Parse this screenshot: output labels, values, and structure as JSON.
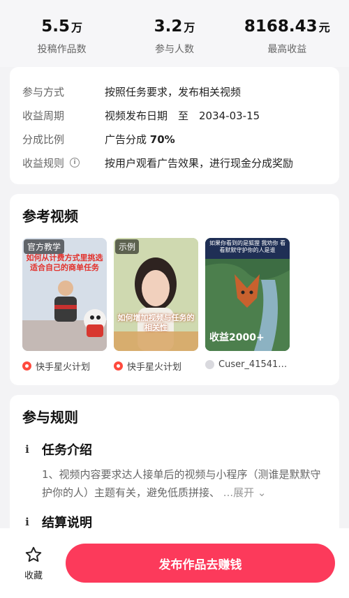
{
  "stats": [
    {
      "value": "5.5",
      "unit": "万",
      "label": "投稿作品数"
    },
    {
      "value": "3.2",
      "unit": "万",
      "label": "参与人数"
    },
    {
      "value": "8168.43",
      "unit": "元",
      "label": "最高收益"
    }
  ],
  "info": {
    "rows": [
      {
        "key": "参与方式",
        "value": "按照任务要求，发布相关视频"
      },
      {
        "key": "收益周期",
        "value": "视频发布日期　至　2034-03-15"
      },
      {
        "key": "分成比例",
        "value_prefix": "广告分成 ",
        "value_bold": "70%"
      },
      {
        "key": "收益规则",
        "value": "按用户观看广告效果，进行现金分成奖励",
        "icon": "info-circle-icon"
      }
    ]
  },
  "reference": {
    "title": "参考视频",
    "videos": [
      {
        "tag": "官方教学",
        "overlay": "如何从计费方式里挑选 适合自己的商单任务",
        "author": "快手星火计划",
        "author_icon": "kuaishou-logo-icon"
      },
      {
        "tag": "示例",
        "overlay": "如何增加视频与任务的 相关性",
        "author": "快手星火计划",
        "author_icon": "kuaishou-logo-icon"
      },
      {
        "tag": "",
        "overlay": "如果你看到的是狐狸 我劝你 看看默默守护你的人是谁",
        "badge": "收益2000+",
        "author": "Cuser_4154106...",
        "author_icon": "user-avatar-icon"
      }
    ]
  },
  "rules": {
    "title": "参与规则",
    "items": [
      {
        "title": "任务介绍",
        "body": "1、视频内容要求达人接单后的视频与小程序（测谁是默默守护你的人）主题有关，避免低质拼接、",
        "expand": "...展开"
      },
      {
        "title": "结算说明"
      }
    ]
  },
  "bottom": {
    "favorite_label": "收藏",
    "cta_label": "发布作品去赚钱"
  },
  "colors": {
    "accent": "#fc3a5b",
    "brand_icon": "#ff4a3d"
  }
}
